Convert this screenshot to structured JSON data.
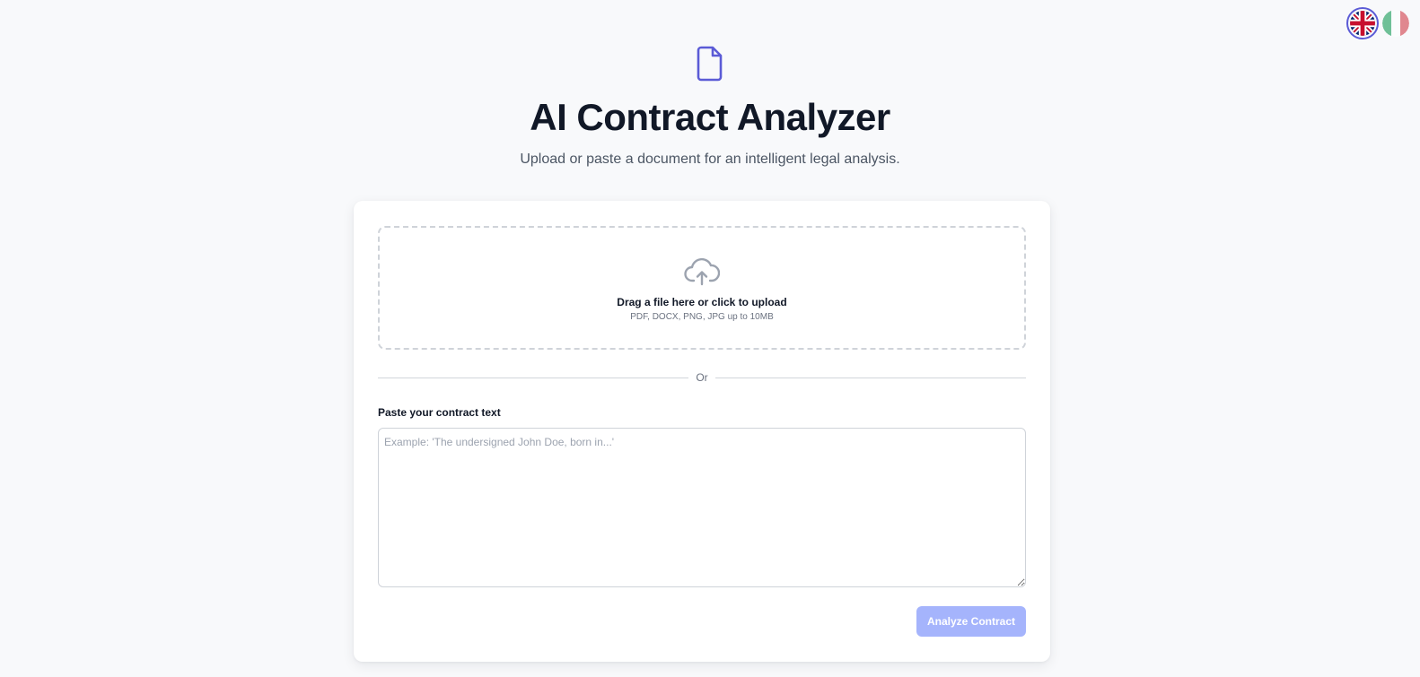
{
  "language_switch": {
    "languages": [
      {
        "code": "en",
        "icon": "uk-flag-icon",
        "active": true
      },
      {
        "code": "it",
        "icon": "italy-flag-icon",
        "active": false
      }
    ]
  },
  "header": {
    "icon": "document-icon",
    "title": "AI Contract Analyzer",
    "subtitle": "Upload or paste a document for an intelligent legal analysis."
  },
  "upload": {
    "icon": "cloud-upload-icon",
    "title": "Drag a file here or click to upload",
    "hint": "PDF, DOCX, PNG, JPG up to 10MB"
  },
  "divider": {
    "label": "Or"
  },
  "paste": {
    "label": "Paste your contract text",
    "placeholder": "Example: 'The undersigned John Doe, born in...'",
    "value": ""
  },
  "actions": {
    "analyze_label": "Analyze Contract",
    "analyze_disabled": true
  },
  "colors": {
    "accent": "#5b5bd6",
    "button_disabled": "#a5b4fc",
    "background": "#f8f9fb"
  }
}
